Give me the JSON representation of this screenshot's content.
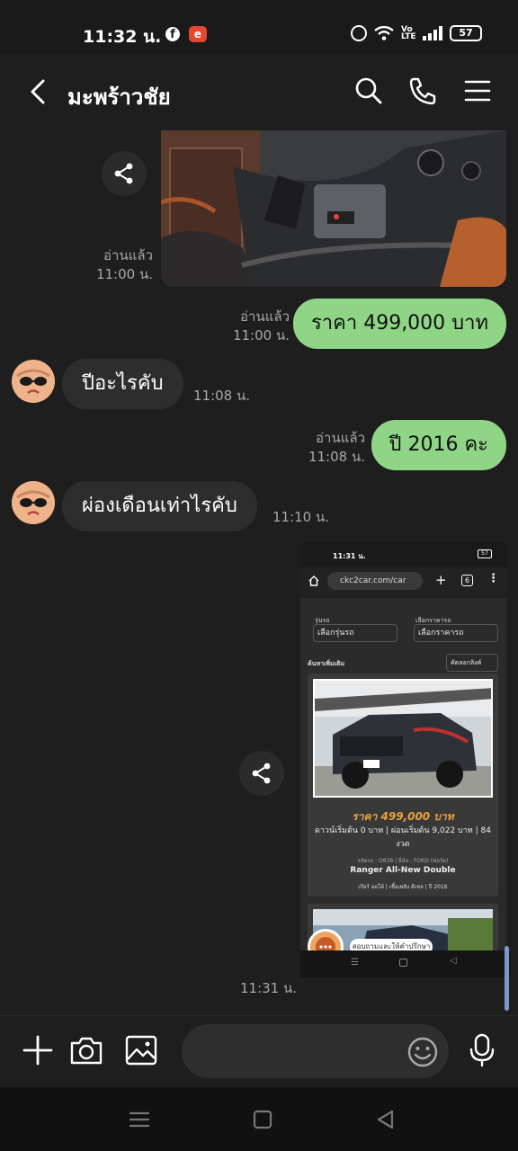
{
  "status_bar": {
    "time": "11:32 น.",
    "fb_icon": "f",
    "app_icon": "e",
    "volte": "Vo LTE",
    "battery": "57"
  },
  "header": {
    "title": "มะพร้าวชัย"
  },
  "messages": [
    {
      "type": "image-out",
      "read": "อ่านแล้ว",
      "time": "11:00 น."
    },
    {
      "type": "text-out",
      "text": "ราคา 499,000 บาท",
      "read": "อ่านแล้ว",
      "time": "11:00 น."
    },
    {
      "type": "text-in",
      "text": "ปีอะไรคับ",
      "time": "11:08 น."
    },
    {
      "type": "text-out",
      "text": "ปี 2016 คะ",
      "read": "อ่านแล้ว",
      "time": "11:08 น."
    },
    {
      "type": "text-in",
      "text": "ผ่องเดือนเท่าไรคับ",
      "time": "11:10 น."
    },
    {
      "type": "image-in",
      "time": "11:31 น."
    }
  ],
  "screenshot": {
    "time": "11:31 น.",
    "battery": "57",
    "url": "ckc2car.com/car",
    "tab_count": "6",
    "label_model": "รุ่นรถ",
    "select_model": "เลือกรุ่นรถ",
    "label_price": "เลือกราคารถ",
    "select_price": "เลือกราคารถ",
    "more_search": "ค้นหาเพิ่มเติม",
    "copy_link": "คัดลอกลิงค์",
    "price": "ราคา 499,000 บาท",
    "finance": "ดาวน์เริ่มต้น 0 บาท | ผ่อนเริ่มต้น 9,022 บาท | 84 งวด",
    "finance_highlight": "9,022",
    "meta": "รหัสรถ : O838 | ยี่ห้อ : FORD (ฟอร์ด)",
    "model_name": "Ranger All-New Double",
    "specs": "เกียร์ ออโต้ | เชื้อเพลิง ดีเซล | ปี 2016",
    "consult": "สอบถามและให้คำปรึกษา"
  },
  "input": {
    "placeholder": ""
  },
  "colors": {
    "bubble_out": "#8fd586",
    "bubble_in": "#2d2d2d",
    "background": "#1e1e1e",
    "price_orange": "#e8a23a"
  }
}
